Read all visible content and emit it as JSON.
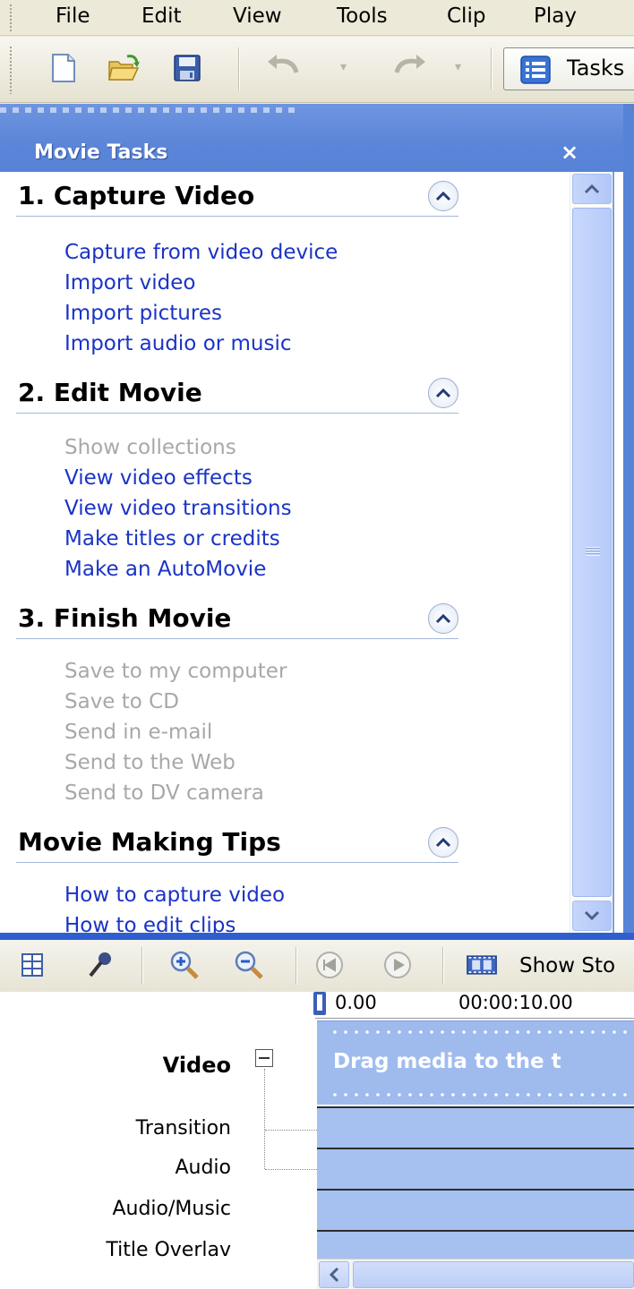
{
  "menu": {
    "items": [
      "File",
      "Edit",
      "View",
      "Tools",
      "Clip",
      "Play"
    ]
  },
  "toolbar": {
    "tasks_label": "Tasks"
  },
  "tasks_pane": {
    "title": "Movie Tasks",
    "close_glyph": "×",
    "sections": [
      {
        "title": "1. Capture Video",
        "links": [
          {
            "label": "Capture from video device",
            "enabled": true
          },
          {
            "label": "Import video",
            "enabled": true
          },
          {
            "label": "Import pictures",
            "enabled": true
          },
          {
            "label": "Import audio or music",
            "enabled": true
          }
        ]
      },
      {
        "title": "2. Edit Movie",
        "links": [
          {
            "label": "Show collections",
            "enabled": false
          },
          {
            "label": "View video effects",
            "enabled": true
          },
          {
            "label": "View video transitions",
            "enabled": true
          },
          {
            "label": "Make titles or credits",
            "enabled": true
          },
          {
            "label": "Make an AutoMovie",
            "enabled": true
          }
        ]
      },
      {
        "title": "3. Finish Movie",
        "links": [
          {
            "label": "Save to my computer",
            "enabled": false
          },
          {
            "label": "Save to CD",
            "enabled": false
          },
          {
            "label": "Send in e-mail",
            "enabled": false
          },
          {
            "label": "Send to the Web",
            "enabled": false
          },
          {
            "label": "Send to DV camera",
            "enabled": false
          }
        ]
      },
      {
        "title": "Movie Making Tips",
        "links": [
          {
            "label": "How to capture video",
            "enabled": true
          },
          {
            "label": "How to edit clips",
            "enabled": true
          }
        ]
      }
    ]
  },
  "timeline": {
    "show_storyboard_label": "Show Sto",
    "ruler": {
      "start": "0.00",
      "mark": "00:00:10.00"
    },
    "tracks": {
      "video": "Video",
      "transition": "Transition",
      "audio": "Audio",
      "audio_music": "Audio/Music",
      "title_overlay": "Title Overlav"
    },
    "drag_message": "Drag media to the t"
  },
  "colors": {
    "pane_header": "#5b85d8",
    "link": "#1a33c6",
    "disabled_link": "#a8a8a8",
    "track_fill": "#a6c0ef"
  },
  "icons": [
    "new-project-icon",
    "open-project-icon",
    "save-project-icon",
    "undo-icon",
    "redo-icon",
    "tasks-icon",
    "storyboard-icon",
    "narrate-icon",
    "zoom-in-icon",
    "zoom-out-icon",
    "rewind-icon",
    "play-icon",
    "filmstrip-icon"
  ]
}
